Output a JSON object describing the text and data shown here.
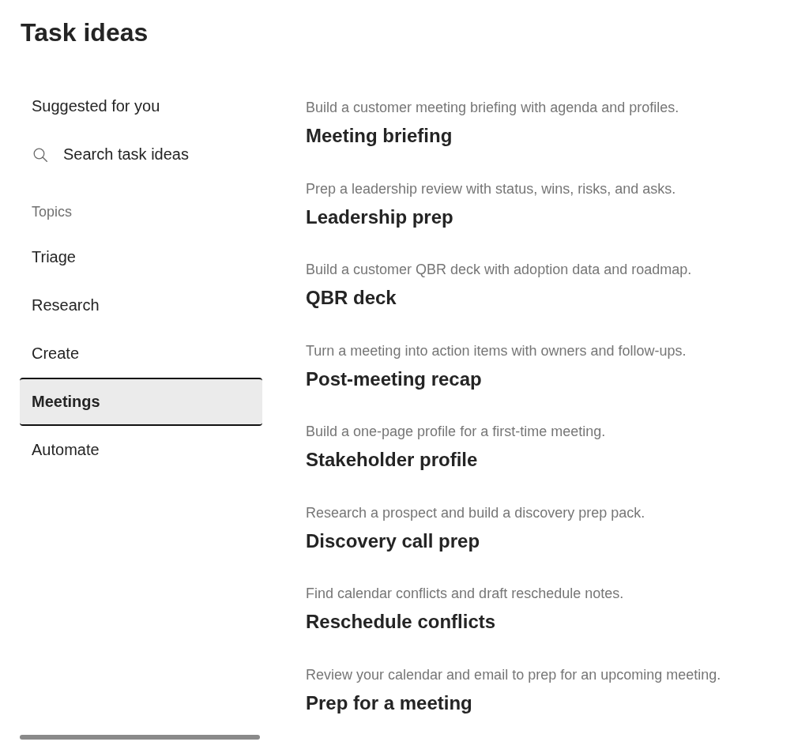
{
  "title": "Task ideas",
  "sidebar": {
    "suggested": {
      "label": "Suggested for you"
    },
    "search": {
      "label": "Search task ideas"
    },
    "topics_label": "Topics",
    "topics": [
      {
        "label": "Triage",
        "selected": false
      },
      {
        "label": "Research",
        "selected": false
      },
      {
        "label": "Create",
        "selected": false
      },
      {
        "label": "Meetings",
        "selected": true
      },
      {
        "label": "Automate",
        "selected": false
      }
    ]
  },
  "ideas": [
    {
      "description": "Build a customer meeting briefing with agenda and profiles.",
      "title": "Meeting briefing"
    },
    {
      "description": "Prep a leadership review with status, wins, risks, and asks.",
      "title": "Leadership prep"
    },
    {
      "description": "Build a customer QBR deck with adoption data and roadmap.",
      "title": "QBR deck"
    },
    {
      "description": "Turn a meeting into action items with owners and follow-ups.",
      "title": "Post-meeting recap"
    },
    {
      "description": "Build a one-page profile for a first-time meeting.",
      "title": "Stakeholder profile"
    },
    {
      "description": "Research a prospect and build a discovery prep pack.",
      "title": "Discovery call prep"
    },
    {
      "description": "Find calendar conflicts and draft reschedule notes.",
      "title": "Reschedule conflicts"
    },
    {
      "description": "Review your calendar and email to prep for an upcoming meeting.",
      "title": "Prep for a meeting"
    }
  ]
}
